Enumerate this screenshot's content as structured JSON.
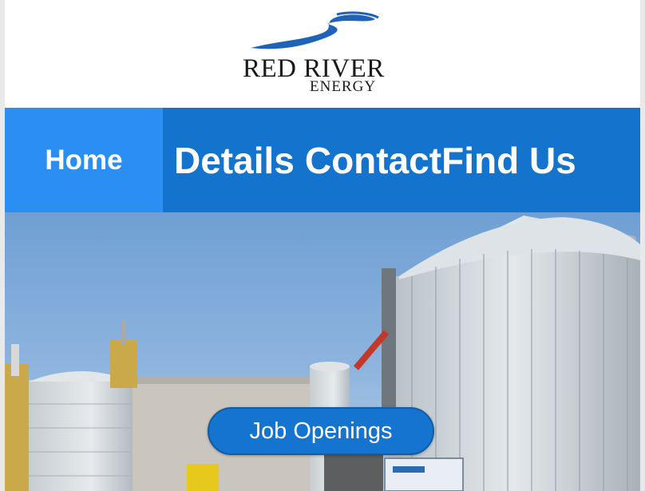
{
  "logo": {
    "name": "RED RIVER",
    "sub": "ENERGY",
    "icon": "river-swoosh-logo"
  },
  "nav": {
    "items": [
      {
        "label": "Home",
        "active": true
      },
      {
        "label": "Details"
      },
      {
        "label": "Contact"
      },
      {
        "label": "Find Us"
      }
    ]
  },
  "hero": {
    "image": "ethanol-plant-grain-bins-photo",
    "cta_label": "Job Openings"
  },
  "colors": {
    "nav_bg": "#1473cc",
    "nav_active": "#2b8ef2",
    "button": "#1474d0",
    "logo_blue": "#1e63b8"
  }
}
